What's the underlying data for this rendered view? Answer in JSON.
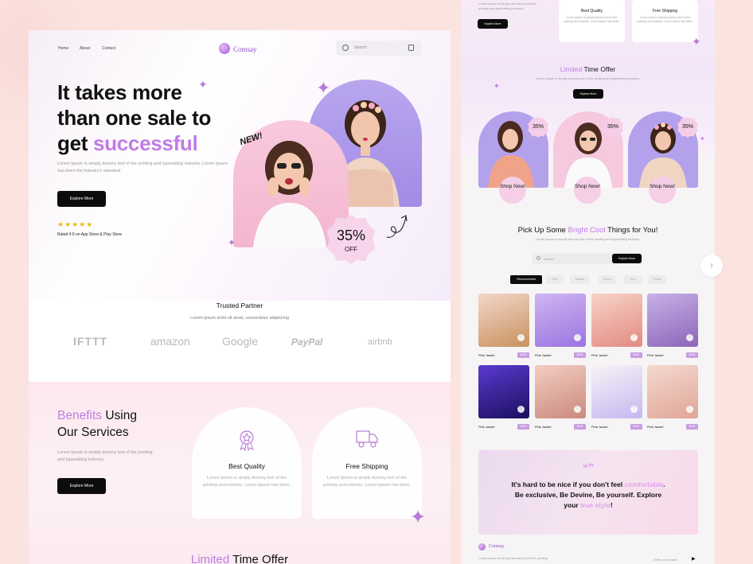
{
  "left": {
    "nav": [
      "Home",
      "About",
      "Contact"
    ],
    "brand": "Comsay",
    "search_placeholder": "Search",
    "hero_line1": "It takes more",
    "hero_line2": "than one sale to",
    "hero_line3_prefix": "get ",
    "hero_line3_accent": "successful",
    "hero_desc": "Lorem Ipsum is simply dummy text of the printing and typesetting industry. Lorem Ipsum has been the industry's standard.",
    "explore_label": "Explore More",
    "stars": "★★★★★",
    "rating": 4.9,
    "rated_text": "Rated 4.9 on App Store & Play Store",
    "new_label": "NEW!",
    "discount_pct": "35%",
    "discount_off": "OFF",
    "trusted_title": "Trusted Partner",
    "trusted_sub": "Lorem ipsum dolor sit amet, consectetur adipiscing",
    "partners": [
      "IFTTT",
      "amazon",
      "Google",
      "PayPal",
      "airbnb"
    ],
    "benefits_accent": "Benefits",
    "benefits_rest": " Using",
    "benefits_line2": "Our Services",
    "benefits_desc": "Lorem Ipsum is simply dummy text of the printing and typesetting industry.",
    "benefits_button": "Explore More",
    "benefit_cards": [
      {
        "title": "Best Quality",
        "desc": "Lorem Ipsum is simply dummy text of the printing and industry. Lorem Ipsum has been.",
        "icon": "badge-icon"
      },
      {
        "title": "Free Shipping",
        "desc": "Lorem Ipsum is simply dummy text of the printing and industry. Lorem Ipsum has been.",
        "icon": "truck-icon"
      }
    ],
    "bottom_accent": "Limited",
    "bottom_rest": " Time Offer"
  },
  "right": {
    "top_text": "Lorem Ipsum is simply dummy text of the printing and typesetting industry.",
    "top_button": "Explore More",
    "top_cards": [
      {
        "title": "Best Quality",
        "desc": "Lorem Ipsum is simply dummy text of the printing and industry. Lorem Ipsum has been."
      },
      {
        "title": "Free Shipping",
        "desc": "Lorem Ipsum is simply dummy text of the printing and industry. Lorem Ipsum has been."
      }
    ],
    "offer_accent": "Limited",
    "offer_rest": " Time Offer",
    "offer_desc": "Lorem Ipsum is simply dummy text of the printing and typesetting industry.",
    "offer_button": "Explore More",
    "offers": [
      {
        "badge": "35%",
        "shop": "Shop Now!",
        "bg": "#b3a1ec"
      },
      {
        "badge": "35%",
        "shop": "Shop Now!",
        "bg": "#f6c9df"
      },
      {
        "badge": "35%",
        "shop": "Shop Now!",
        "bg": "#b3a1ec"
      }
    ],
    "pick_prefix": "Pick Up Some ",
    "pick_accent": "Bright Cool",
    "pick_suffix": " Things for You!",
    "pick_desc": "Lorem Ipsum is simply dummy text of the printing and typesetting industry.",
    "search_placeholder": "Search",
    "search_button": "Explore More",
    "filters": [
      "Recommended",
      "Shirt",
      "Jackets",
      "Shoes",
      "Suit",
      "Dress"
    ],
    "products": [
      {
        "name": "Pink Jacket",
        "price": "$100",
        "c1": "#f2d7c9",
        "c2": "#c9915f"
      },
      {
        "name": "Pink Jacket",
        "price": "$100",
        "c1": "#cfb6f1",
        "c2": "#9a74e0"
      },
      {
        "name": "Pink Jacket",
        "price": "$100",
        "c1": "#f7d3c8",
        "c2": "#e38a82"
      },
      {
        "name": "Pink Jacket",
        "price": "$100",
        "c1": "#c7b0e6",
        "c2": "#8c66b9"
      },
      {
        "name": "Pink Jacket",
        "price": "$100",
        "c1": "#5a3ad0",
        "c2": "#1c0f5e"
      },
      {
        "name": "Pink Jacket",
        "price": "$100",
        "c1": "#f4cdc2",
        "c2": "#c98a7d"
      },
      {
        "name": "Pink Jacket",
        "price": "$100",
        "c1": "#f8f3f6",
        "c2": "#c6b7f0"
      },
      {
        "name": "Pink Jacket",
        "price": "$100",
        "c1": "#f5d8cf",
        "c2": "#e0a698"
      }
    ],
    "quote_mark": "❝❞",
    "quote_line1_prefix": "It's hard to be nice if you don't feel ",
    "quote_line1_accent": "comfortable",
    "quote_line1_suffix": ".",
    "quote_line2": "Be exclusive, Be Devine, Be yourself. Explore",
    "quote_line3_prefix": "your ",
    "quote_line3_accent": "true style",
    "quote_line3_suffix": "!",
    "footer_brand": "Comsay",
    "footer_text": "Lorem Ipsum is simply dummy text of the printing",
    "footer_email_placeholder": "Enter your email"
  },
  "colors": {
    "accent": "#c07be6",
    "pink": "#f6c9df",
    "lavender": "#b3a1ec",
    "black": "#0c0c0c"
  }
}
